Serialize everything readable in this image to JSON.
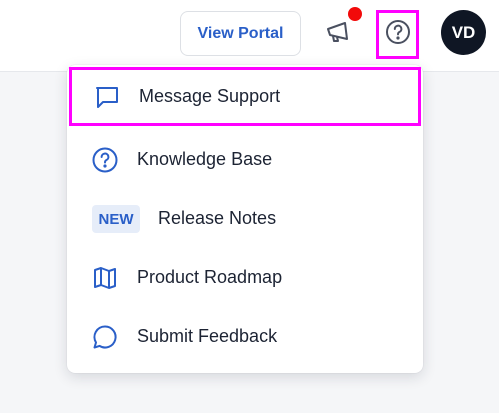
{
  "header": {
    "view_portal_label": "View Portal",
    "avatar_initials": "VD",
    "announcement_icon": "megaphone-icon",
    "help_icon": "question-circle-icon",
    "notification_color": "#f20a0a"
  },
  "help_menu": {
    "items": [
      {
        "label": "Message Support",
        "icon": "chat-bubble-icon"
      },
      {
        "label": "Knowledge Base",
        "icon": "question-circle-icon"
      },
      {
        "label": "Release Notes",
        "badge": "NEW"
      },
      {
        "label": "Product Roadmap",
        "icon": "map-icon"
      },
      {
        "label": "Submit Feedback",
        "icon": "speech-bubble-icon"
      }
    ]
  },
  "colors": {
    "accent": "#2a5fc8",
    "highlight_outline": "#ff00ff",
    "avatar_bg": "#0f1624"
  }
}
